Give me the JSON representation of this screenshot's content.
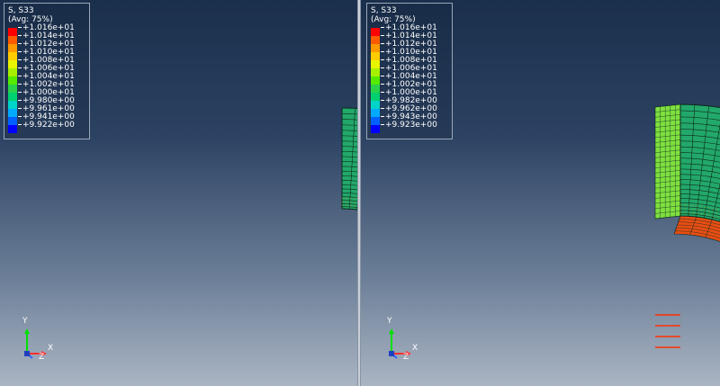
{
  "viewports": [
    {
      "legend": {
        "title": "S, S33",
        "subtitle": "(Avg: 75%)",
        "entries": [
          "+1.016e+01",
          "+1.014e+01",
          "+1.012e+01",
          "+1.010e+01",
          "+1.008e+01",
          "+1.006e+01",
          "+1.004e+01",
          "+1.002e+01",
          "+1.000e+01",
          "+9.980e+00",
          "+9.961e+00",
          "+9.941e+00",
          "+9.922e+00"
        ]
      },
      "triad": {
        "y": "Y",
        "x": "X",
        "z": "Z"
      }
    },
    {
      "legend": {
        "title": "S, S33",
        "subtitle": "(Avg: 75%)",
        "entries": [
          "+1.016e+01",
          "+1.014e+01",
          "+1.012e+01",
          "+1.010e+01",
          "+1.008e+01",
          "+1.006e+01",
          "+1.004e+01",
          "+1.002e+01",
          "+1.000e+01",
          "+9.982e+00",
          "+9.962e+00",
          "+9.943e+00",
          "+9.923e+00"
        ]
      },
      "triad": {
        "y": "Y",
        "x": "X",
        "z": "Z"
      }
    }
  ],
  "colors": {
    "contour": [
      "#ff0000",
      "#ff5a00",
      "#ff9900",
      "#ffcc00",
      "#e8f400",
      "#a6f000",
      "#55ea00",
      "#2ad24a",
      "#00d070",
      "#00d4c8",
      "#00aaff",
      "#0060ff",
      "#0000ff"
    ],
    "mesh_fill": "#22a86a",
    "mesh_line": "#0d2a1c",
    "inner_face": "#e84e14",
    "side_face": "#7fe040"
  }
}
